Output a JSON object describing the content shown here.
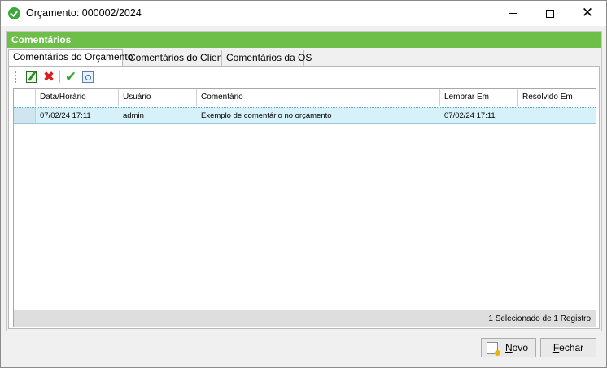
{
  "window": {
    "title": "Orçamento: 000002/2024",
    "controls": [
      "minimize",
      "maximize",
      "close"
    ]
  },
  "panel": {
    "header": "Comentários"
  },
  "tabs": [
    {
      "label": "Comentários do Orçamento",
      "active": true
    },
    {
      "label": "Comentários do Cliente",
      "active": false
    },
    {
      "label": "Comentários da OS",
      "active": false
    }
  ],
  "toolbar": {
    "icons": [
      "edit-icon",
      "delete-icon",
      "confirm-icon",
      "view-icon"
    ]
  },
  "grid": {
    "columns": [
      "Data/Horário",
      "Usuário",
      "Comentário",
      "Lembrar Em",
      "Resolvido Em"
    ],
    "rows": [
      {
        "data_horario": "07/02/24 17:11",
        "usuario": "admin",
        "comentario": "Exemplo de comentário no orçamento",
        "lembrar_em": "07/02/24 17:11",
        "resolvido_em": ""
      }
    ],
    "footer": "1 Selecionado de 1 Registro"
  },
  "buttons": {
    "novo_first": "N",
    "novo_rest": "ovo",
    "fechar_first": "F",
    "fechar_rest": "echar"
  },
  "colors": {
    "panel_header": "#6dbf4a",
    "selected_row": "#d7f1fa"
  }
}
